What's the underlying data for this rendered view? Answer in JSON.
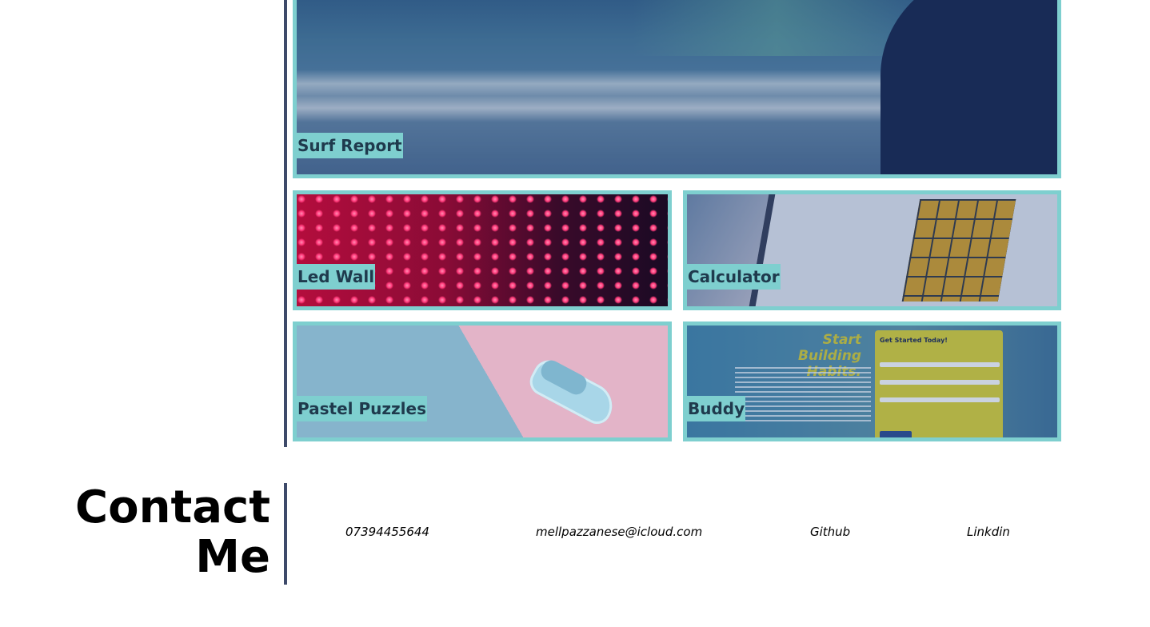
{
  "projects": [
    {
      "title": "Surf Report"
    },
    {
      "title": "Led Wall"
    },
    {
      "title": "Calculator"
    },
    {
      "title": "Pastel Puzzles"
    },
    {
      "title": "Buddy"
    }
  ],
  "buddy_screenshot": {
    "heading": "Start Building Habits.",
    "panel_title": "Get Started Today!"
  },
  "contact": {
    "title_line1": "Contact",
    "title_line2": "Me",
    "phone": "07394455644",
    "email": "mellpazzanese@icloud.com",
    "github": "Github",
    "linkedin": "Linkdin"
  },
  "colors": {
    "card_border": "#7ecfcf",
    "divider": "#3e4a6a",
    "label_text": "#1f3a4d"
  }
}
